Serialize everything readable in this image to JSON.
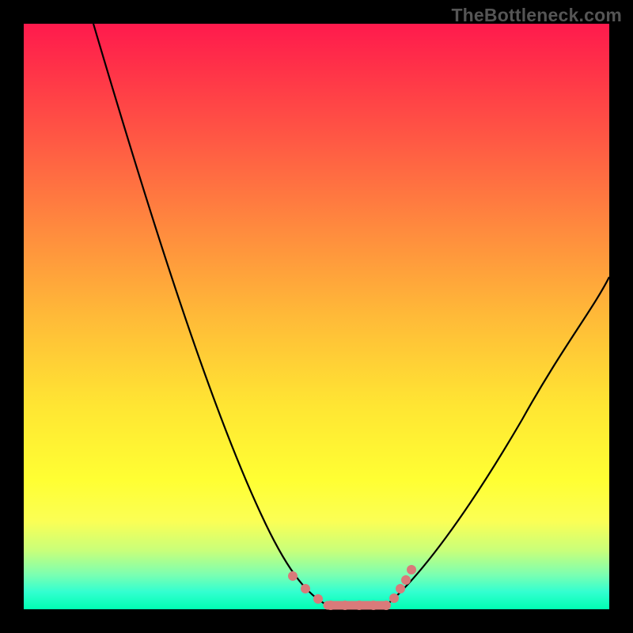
{
  "watermark": "TheBottleneck.com",
  "colors": {
    "frame": "#000000",
    "gradient_top": "#ff1a4d",
    "gradient_bottom": "#00ffb3",
    "curve": "#000000",
    "markers": "#d97a7a"
  },
  "chart_data": {
    "type": "line",
    "title": "",
    "xlabel": "",
    "ylabel": "",
    "xlim": [
      0,
      100
    ],
    "ylim": [
      0,
      100
    ],
    "grid": false,
    "legend": false,
    "series": [
      {
        "name": "left-branch",
        "x": [
          12,
          16,
          20,
          24,
          28,
          32,
          36,
          40,
          44,
          46,
          48,
          50,
          52
        ],
        "y": [
          100,
          88,
          76,
          64,
          52,
          40,
          29,
          19,
          10,
          6,
          3,
          1,
          0
        ]
      },
      {
        "name": "flat-bottom",
        "x": [
          52,
          54,
          56,
          58,
          60,
          62
        ],
        "y": [
          0,
          0,
          0,
          0,
          0,
          0
        ]
      },
      {
        "name": "right-branch",
        "x": [
          62,
          66,
          70,
          74,
          78,
          82,
          86,
          90,
          94,
          98,
          100
        ],
        "y": [
          0,
          3,
          8,
          14,
          21,
          28,
          35,
          42,
          48,
          54,
          57
        ]
      }
    ],
    "markers": {
      "name": "bottom-cluster",
      "points": [
        {
          "x": 46,
          "y": 5
        },
        {
          "x": 48,
          "y": 3
        },
        {
          "x": 50,
          "y": 1
        },
        {
          "x": 52,
          "y": 0
        },
        {
          "x": 54,
          "y": 0
        },
        {
          "x": 56,
          "y": 0
        },
        {
          "x": 58,
          "y": 0
        },
        {
          "x": 60,
          "y": 0
        },
        {
          "x": 62,
          "y": 0
        },
        {
          "x": 63,
          "y": 2
        },
        {
          "x": 64,
          "y": 4
        },
        {
          "x": 65,
          "y": 6
        },
        {
          "x": 66,
          "y": 8
        }
      ]
    }
  }
}
